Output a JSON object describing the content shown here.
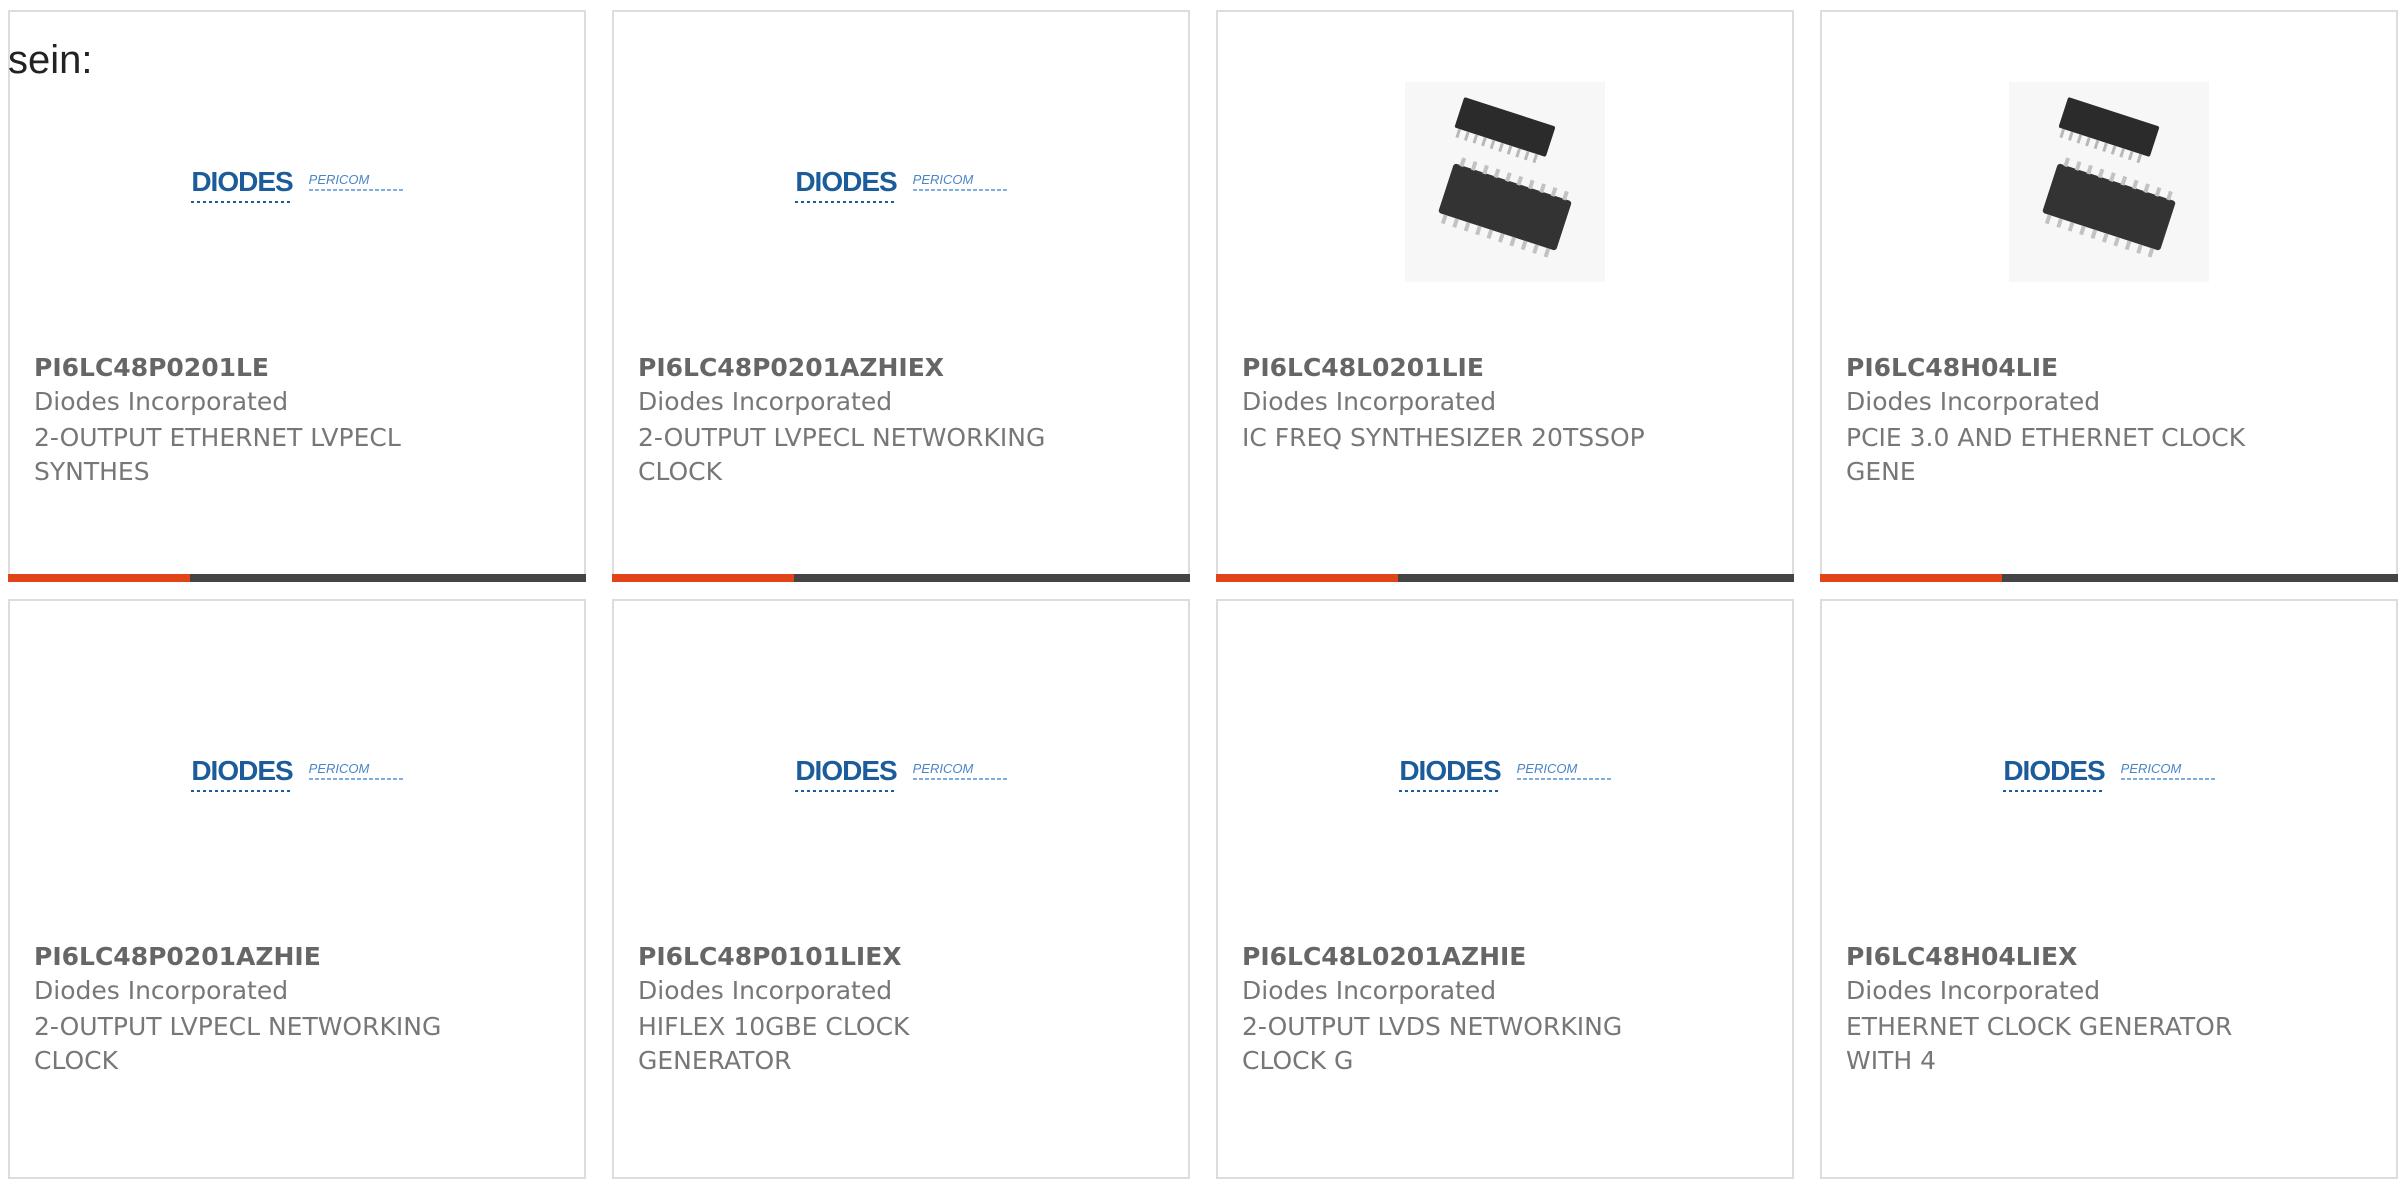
{
  "heading": "sein:",
  "cards": [
    {
      "part": "PI6LC48P0201LE",
      "manufacturer": "Diodes Incorporated",
      "desc_line1": "2-OUTPUT ETHERNET LVPECL",
      "desc_line2": "SYNTHES",
      "image": "diodes-pericom-logo"
    },
    {
      "part": "PI6LC48P0201AZHIEX",
      "manufacturer": "Diodes Incorporated",
      "desc_line1": "2-OUTPUT LVPECL NETWORKING",
      "desc_line2": "CLOCK",
      "image": "diodes-pericom-logo"
    },
    {
      "part": "PI6LC48L0201LIE",
      "manufacturer": "Diodes Incorporated",
      "desc_line1": "IC FREQ SYNTHESIZER 20TSSOP",
      "desc_line2": "",
      "image": "tssop-chip-photo"
    },
    {
      "part": "PI6LC48H04LIE",
      "manufacturer": "Diodes Incorporated",
      "desc_line1": "PCIE 3.0 AND ETHERNET CLOCK",
      "desc_line2": "GENE",
      "image": "tssop-chip-photo"
    },
    {
      "part": "PI6LC48P0201AZHIE",
      "manufacturer": "Diodes Incorporated",
      "desc_line1": "2-OUTPUT LVPECL NETWORKING",
      "desc_line2": "CLOCK",
      "image": "diodes-pericom-logo"
    },
    {
      "part": "PI6LC48P0101LIEX",
      "manufacturer": "Diodes Incorporated",
      "desc_line1": "HIFLEX 10GBE CLOCK",
      "desc_line2": "GENERATOR",
      "image": "diodes-pericom-logo"
    },
    {
      "part": "PI6LC48L0201AZHIE",
      "manufacturer": "Diodes Incorporated",
      "desc_line1": "2-OUTPUT LVDS NETWORKING",
      "desc_line2": "CLOCK G",
      "image": "diodes-pericom-logo"
    },
    {
      "part": "PI6LC48H04LIEX",
      "manufacturer": "Diodes Incorporated",
      "desc_line1": "ETHERNET CLOCK GENERATOR",
      "desc_line2": "WITH 4",
      "image": "diodes-pericom-logo"
    }
  ],
  "logo": {
    "diodes": "DIODES",
    "pericom": "PERICOM"
  },
  "colors": {
    "accent": "#e2441a",
    "bar": "#444444",
    "brand_blue": "#1c5c9a"
  }
}
